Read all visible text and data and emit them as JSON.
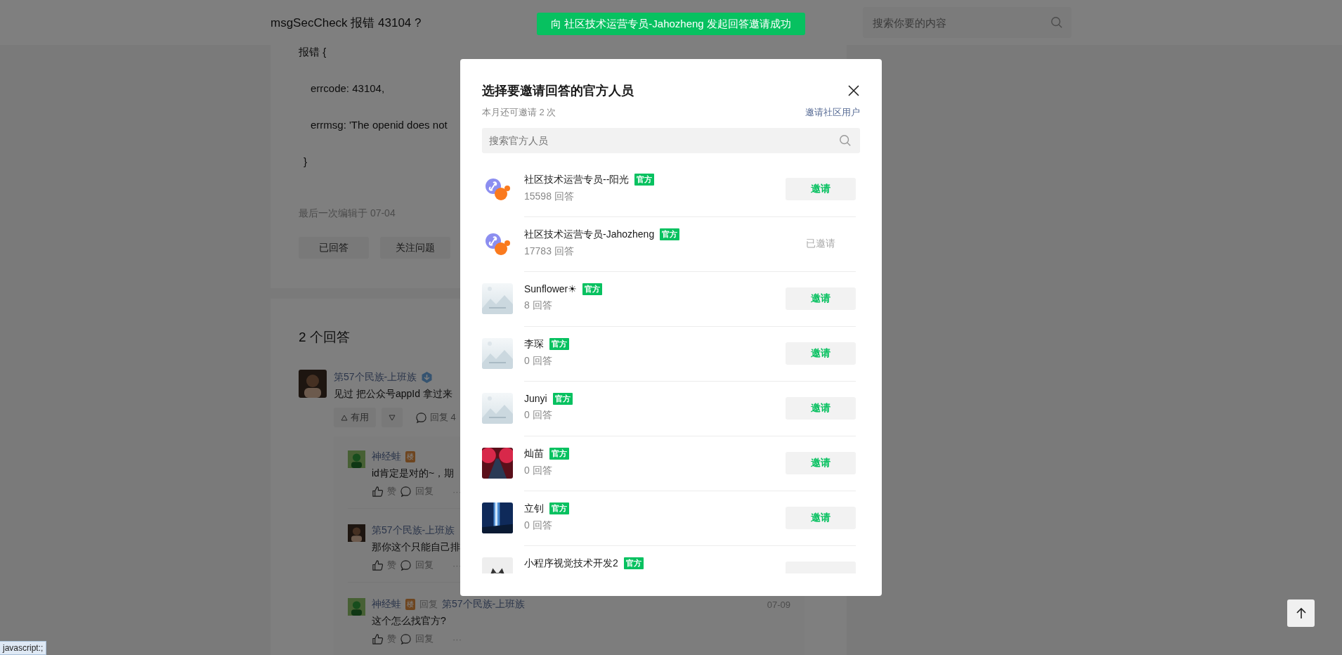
{
  "header": {
    "title": "msgSecCheck 报错 43104 ?",
    "search": {
      "placeholder": "搜索你要的内容"
    }
  },
  "toast": "向 社区技术运营专员-Jahozheng 发起回答邀请成功",
  "question": {
    "lines": [
      {
        "kind": "open",
        "text": "报错 {"
      },
      {
        "kind": "field",
        "text": "errcode: 43104,"
      },
      {
        "kind": "field",
        "text": "errmsg: 'The openid does not"
      },
      {
        "kind": "close",
        "text": "}"
      }
    ],
    "edited": "最后一次编辑于  07-04",
    "buttons": [
      "已回答",
      "关注问题"
    ]
  },
  "answers": {
    "title": "2 个回答",
    "items": [
      {
        "author": "第57个民族-上班族",
        "verified": true,
        "text": "见过 把公众号appId 拿过来",
        "useful": "有用",
        "reply": "回复 4",
        "replies": [
          {
            "author": "神经蛙",
            "avatar": {
              "kind": "frog"
            },
            "floor": "楼",
            "text": "id肯定是对的~，期",
            "like": "赞",
            "reply": "回复",
            "more": "···"
          },
          {
            "author": "第57个民族-上班族",
            "avatar": {
              "kind": "person"
            },
            "text": "那你这个只能自己排",
            "like": "赞",
            "reply": "回复",
            "more": "···"
          },
          {
            "author": "神经蛙",
            "avatar": {
              "kind": "frog"
            },
            "floor": "楼",
            "reply_label": "回复",
            "reply_to": "第57个民族-上班族",
            "time": "07-09",
            "text": "这个怎么找官方?",
            "like": "赞",
            "reply": "回复",
            "more": "···"
          }
        ]
      }
    ]
  },
  "modal": {
    "title": "选择要邀请回答的官方人员",
    "quota": "本月还可邀请 2 次",
    "invite_community": "邀请社区用户",
    "search": {
      "placeholder": "搜索官方人员"
    },
    "members": [
      {
        "avatar": {
          "kind": "logo"
        },
        "name": "社区技术运营专员--阳光",
        "badge": "官方",
        "count": "15598 回答",
        "invited": false,
        "action": "邀请"
      },
      {
        "avatar": {
          "kind": "logo"
        },
        "name": "社区技术运营专员-Jahozheng",
        "badge": "官方",
        "count": "17783 回答",
        "invited": true,
        "action": "已邀请"
      },
      {
        "avatar": {
          "kind": "placeholder"
        },
        "name": "Sunflower☀",
        "badge": "官方",
        "count": "8 回答",
        "invited": false,
        "action": "邀请"
      },
      {
        "avatar": {
          "kind": "placeholder"
        },
        "name": "李琛",
        "badge": "官方",
        "count": "0 回答",
        "invited": false,
        "action": "邀请"
      },
      {
        "avatar": {
          "kind": "placeholder"
        },
        "name": "Junyi",
        "badge": "官方",
        "count": "0 回答",
        "invited": false,
        "action": "邀请"
      },
      {
        "avatar": {
          "kind": "red-road"
        },
        "name": "灿苗",
        "badge": "官方",
        "count": "0 回答",
        "invited": false,
        "action": "邀请"
      },
      {
        "avatar": {
          "kind": "blue-tower"
        },
        "name": "立钊",
        "badge": "官方",
        "count": "0 回答",
        "invited": false,
        "action": "邀请"
      },
      {
        "avatar": {
          "kind": "robot"
        },
        "name": "小程序视觉技术开发2",
        "badge": "官方",
        "invited": false
      }
    ]
  },
  "status_link": "javascript:;"
}
